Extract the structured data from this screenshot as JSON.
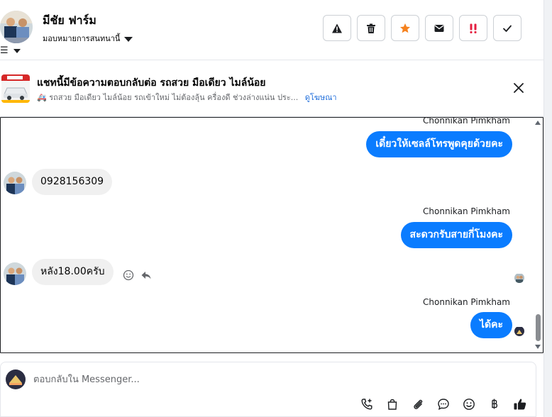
{
  "header": {
    "name": "มีชัย ฟาร์ม",
    "assign_label": "มอบหมายการสนทนานี้",
    "actions": [
      "warning-icon",
      "trash-icon",
      "star-icon",
      "mail-icon",
      "important-icon",
      "check-icon"
    ]
  },
  "ad": {
    "title": "แชทนี้มีข้อความตอบกลับต่อ รถสวย มือเดียว ไมล์น้อย",
    "emoji": "🚑",
    "description": "รถสวย มือเดียว ไมล์น้อย รถเข้าใหม่ ไม่ต้องลุ้น ครื่องดี ช่วงล่างแน่น ประ...",
    "link": "ดูโฆษณา"
  },
  "messages": [
    {
      "sender": "Chonnikan Pimkham",
      "text": "เดี๋ยวให้เซลล์โทรพูดคุยด้วยคะ",
      "direction": "out"
    },
    {
      "text": "0928156309",
      "direction": "in"
    },
    {
      "sender": "Chonnikan Pimkham",
      "text": "สะดวกรับสายกี่โมงคะ",
      "direction": "out"
    },
    {
      "text": "หลัง18.00ครับ",
      "direction": "in"
    },
    {
      "sender": "Chonnikan Pimkham",
      "text": "ได้คะ",
      "direction": "out"
    }
  ],
  "composer": {
    "placeholder": "ตอบกลับใน Messenger...",
    "tools": [
      "phone-add-icon",
      "bag-icon",
      "paperclip-icon",
      "chat-bubble-icon",
      "emoji-icon",
      "baht-icon",
      "thumbs-up-icon"
    ]
  },
  "colors": {
    "outgoing_bubble": "#0a7cff",
    "incoming_bubble": "#f0f0f0",
    "star": "#f5821f",
    "important": "#e41e3f",
    "link": "#216fdb"
  }
}
